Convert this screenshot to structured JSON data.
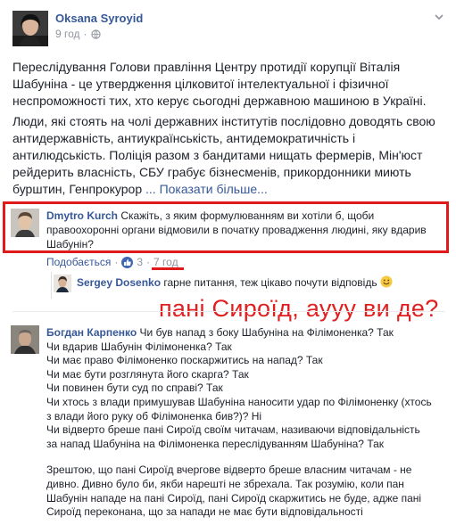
{
  "post": {
    "author": "Oksana Syroyid",
    "time": "9 год",
    "paragraph1": "Переслідування Голови правління Центру протидії корупції Віталія Шабуніна - це утвердження цілковитої інтелектуальної і фізичної неспроможності тих, хто керує сьогодні державною машиною в Україні.",
    "paragraph2": "Люди, які стоять на чолі державних інститутів послідовно доводять свою антидержавність, антиукраїнськість, антидемократичність і антилюдськість. Поліція разом з бандитами нищать фермерів, Мін'юст рейдерить власність, СБУ грабує бізнесменів, прикордонники миють бурштин, Генпрокурор",
    "see_more": "... Показати більше..."
  },
  "comments": [
    {
      "author": "Dmytro Kurch",
      "text": "Скажіть, з яким формулюванням ви хотіли б, щоби правоохоронні органи відмовили в початку провадження людині, яку вдарив Шабунін?",
      "like_label": "Подобається",
      "likes": "3",
      "time": "7 год"
    },
    {
      "author": "Sergey Dosenko",
      "text": "гарне питання, теж цікаво почути відповідь"
    },
    {
      "author": "Богдан Карпенко",
      "lines": [
        "Чи був напад з боку Шабуніна на Філімоненка? Так",
        "Чи вдарив Шабунін Філімоненка? Так",
        "Чи має право Філімоненко поскаржитись на напад? Так",
        "Чи має бути розглянута його скарга? Так",
        "Чи повинен бути суд по справі? Так",
        "Чи хтось з влади примушував Шабуніна наносити удар по Філімоненку (хтось",
        "з влади його руку об Філімоненка бив?)? Ні",
        "Чи відверто бреше пані Сироїд своїм читачам, називаючи відповідальність",
        "за напад Шабуніна на Філімоненка переслідуванням Шабуніна? Так"
      ],
      "para_lines": [
        "Зрештою, що пані Сироїд вчергове відверто бреше власним читачам - не",
        "дивно. Дивно було би, якби нарешті не збрехала. Так розумію, коли пан",
        "Шабунін нападе на пані Сироїд, пані Сироїд скаржитись не буде, адже пані",
        "Сироїд переконана, що за напади не має бути відповідальності"
      ]
    }
  ],
  "annotation": "пані Сироїд, аууу ви де?",
  "icons": [
    "chevron-down-icon",
    "globe-icon",
    "like-icon",
    "smile-emoji-icon"
  ]
}
